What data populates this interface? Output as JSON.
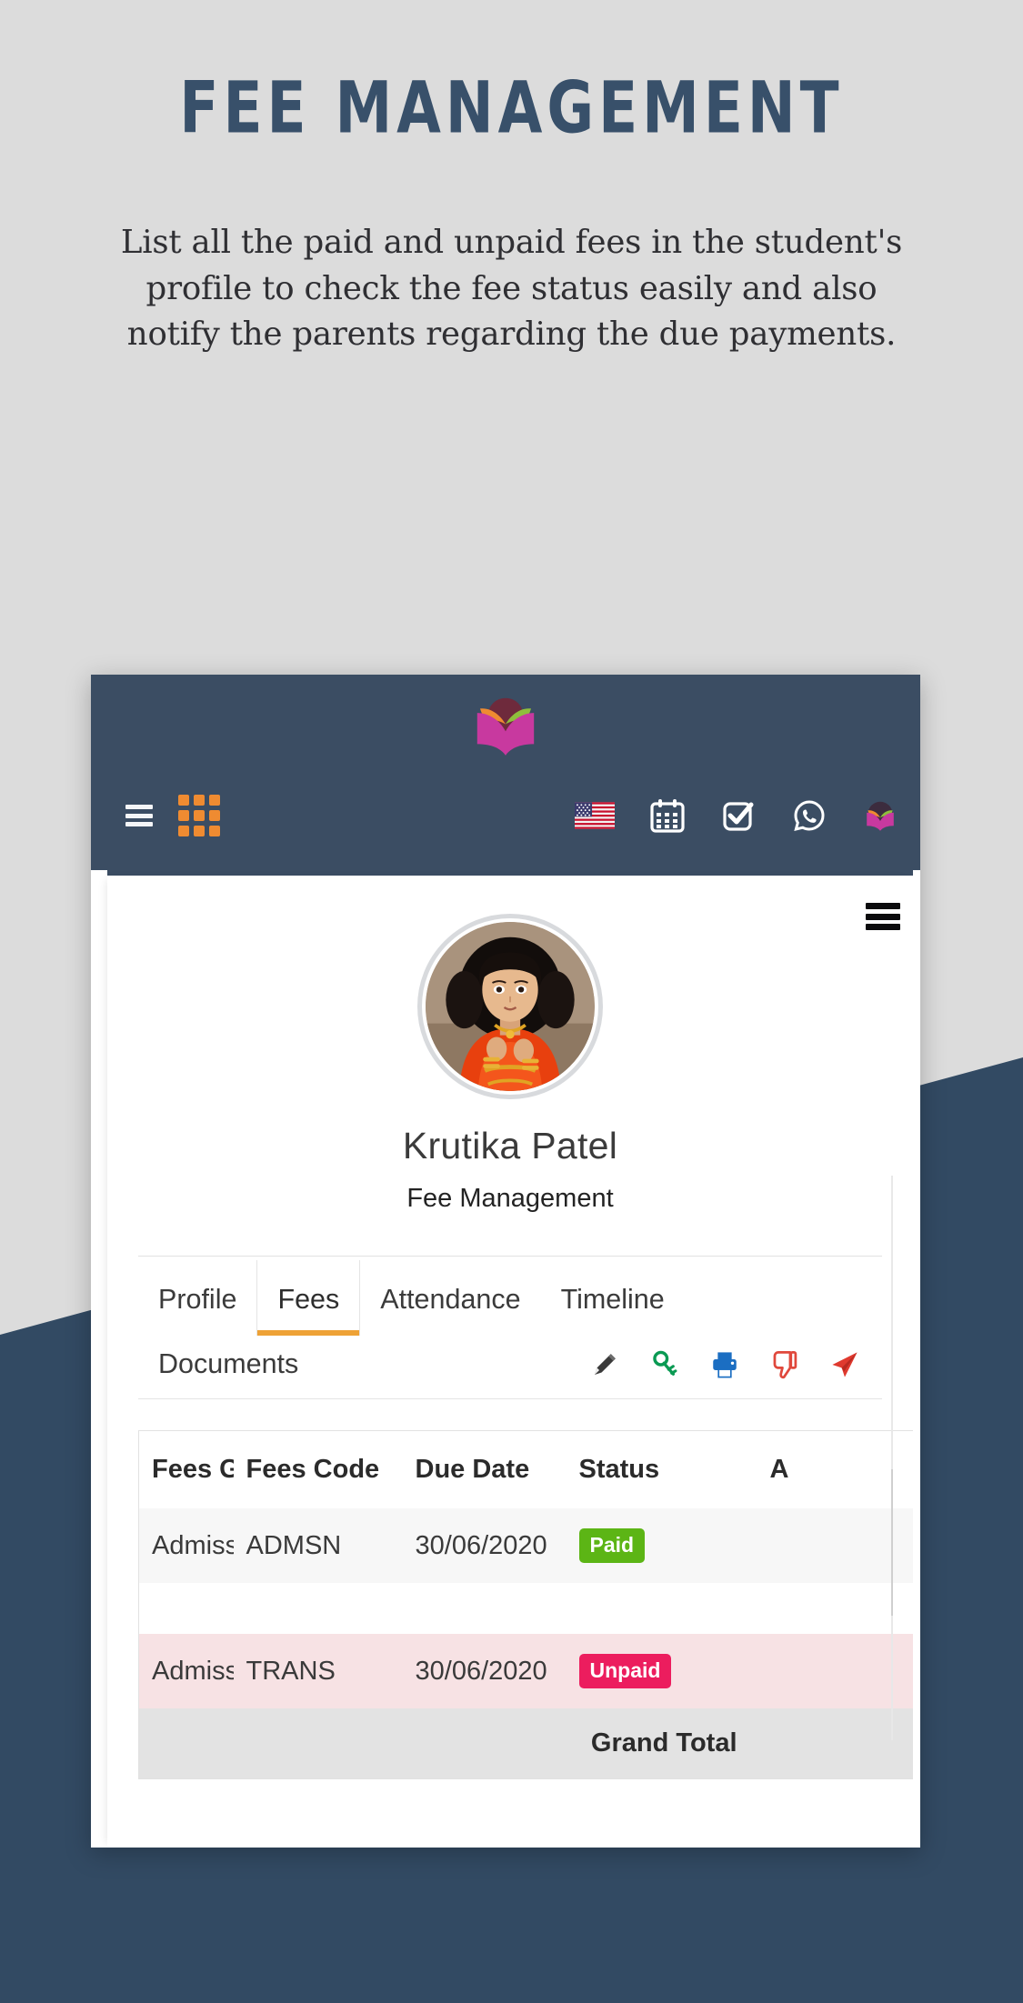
{
  "promo": {
    "title": "FEE MANAGEMENT",
    "description": "List all the paid and unpaid fees in the student's profile to check the fee status easily and also notify the parents regarding the due payments.",
    "title_color": "#38506a",
    "background_color": "#dcdcdc",
    "accent_navy": "#324a63"
  },
  "appbar": {
    "background_color": "#3b4d63",
    "logo_icon": "open-book-logo",
    "menu_icon": "hamburger-icon",
    "apps_icon": "grid-apps-icon",
    "apps_color": "#ef8b31",
    "right_icons": [
      {
        "name": "us-flag-icon",
        "label": "English (US)"
      },
      {
        "name": "calendar-icon",
        "label": "Calendar"
      },
      {
        "name": "checkbox-icon",
        "label": "Tasks"
      },
      {
        "name": "whatsapp-icon",
        "label": "WhatsApp"
      },
      {
        "name": "open-book-logo-icon",
        "label": "School"
      }
    ]
  },
  "screen": {
    "corner_menu_icon": "hamburger-icon",
    "profile": {
      "avatar_alt": "Student photo",
      "name": "Krutika Patel",
      "role": "Fee Management"
    },
    "tabs": [
      {
        "label": "Profile",
        "active": false
      },
      {
        "label": "Fees",
        "active": true
      },
      {
        "label": "Attendance",
        "active": false
      },
      {
        "label": "Timeline",
        "active": false
      }
    ],
    "tools": {
      "label": "Documents",
      "icons": [
        {
          "name": "edit-pencil-icon",
          "color": "#3a3a3a"
        },
        {
          "name": "key-icon",
          "color": "#0a9a53"
        },
        {
          "name": "print-icon",
          "color": "#1b6ec2"
        },
        {
          "name": "thumbs-down-icon",
          "color": "#e0483c"
        },
        {
          "name": "send-icon",
          "color": "#e03a2f"
        }
      ]
    },
    "table": {
      "columns": [
        "Fees Group",
        "Fees Code",
        "Due Date",
        "Status",
        "A"
      ],
      "rows": [
        {
          "type": "data",
          "fees_group": "Admission",
          "fees_code": "ADMSN",
          "due_date": "30/06/2020",
          "status": "Paid",
          "status_kind": "paid",
          "amount": ""
        },
        {
          "type": "blank",
          "fees_group": "",
          "fees_code": "",
          "due_date": "",
          "status": "",
          "status_kind": "",
          "amount": ""
        },
        {
          "type": "data",
          "fees_group": "Admission",
          "fees_code": "TRANS",
          "due_date": "30/06/2020",
          "status": "Unpaid",
          "status_kind": "unpaid",
          "amount": ""
        }
      ],
      "footer_label": "Grand Total",
      "paid_color": "#5cb515",
      "unpaid_color": "#ec1d5e"
    }
  }
}
